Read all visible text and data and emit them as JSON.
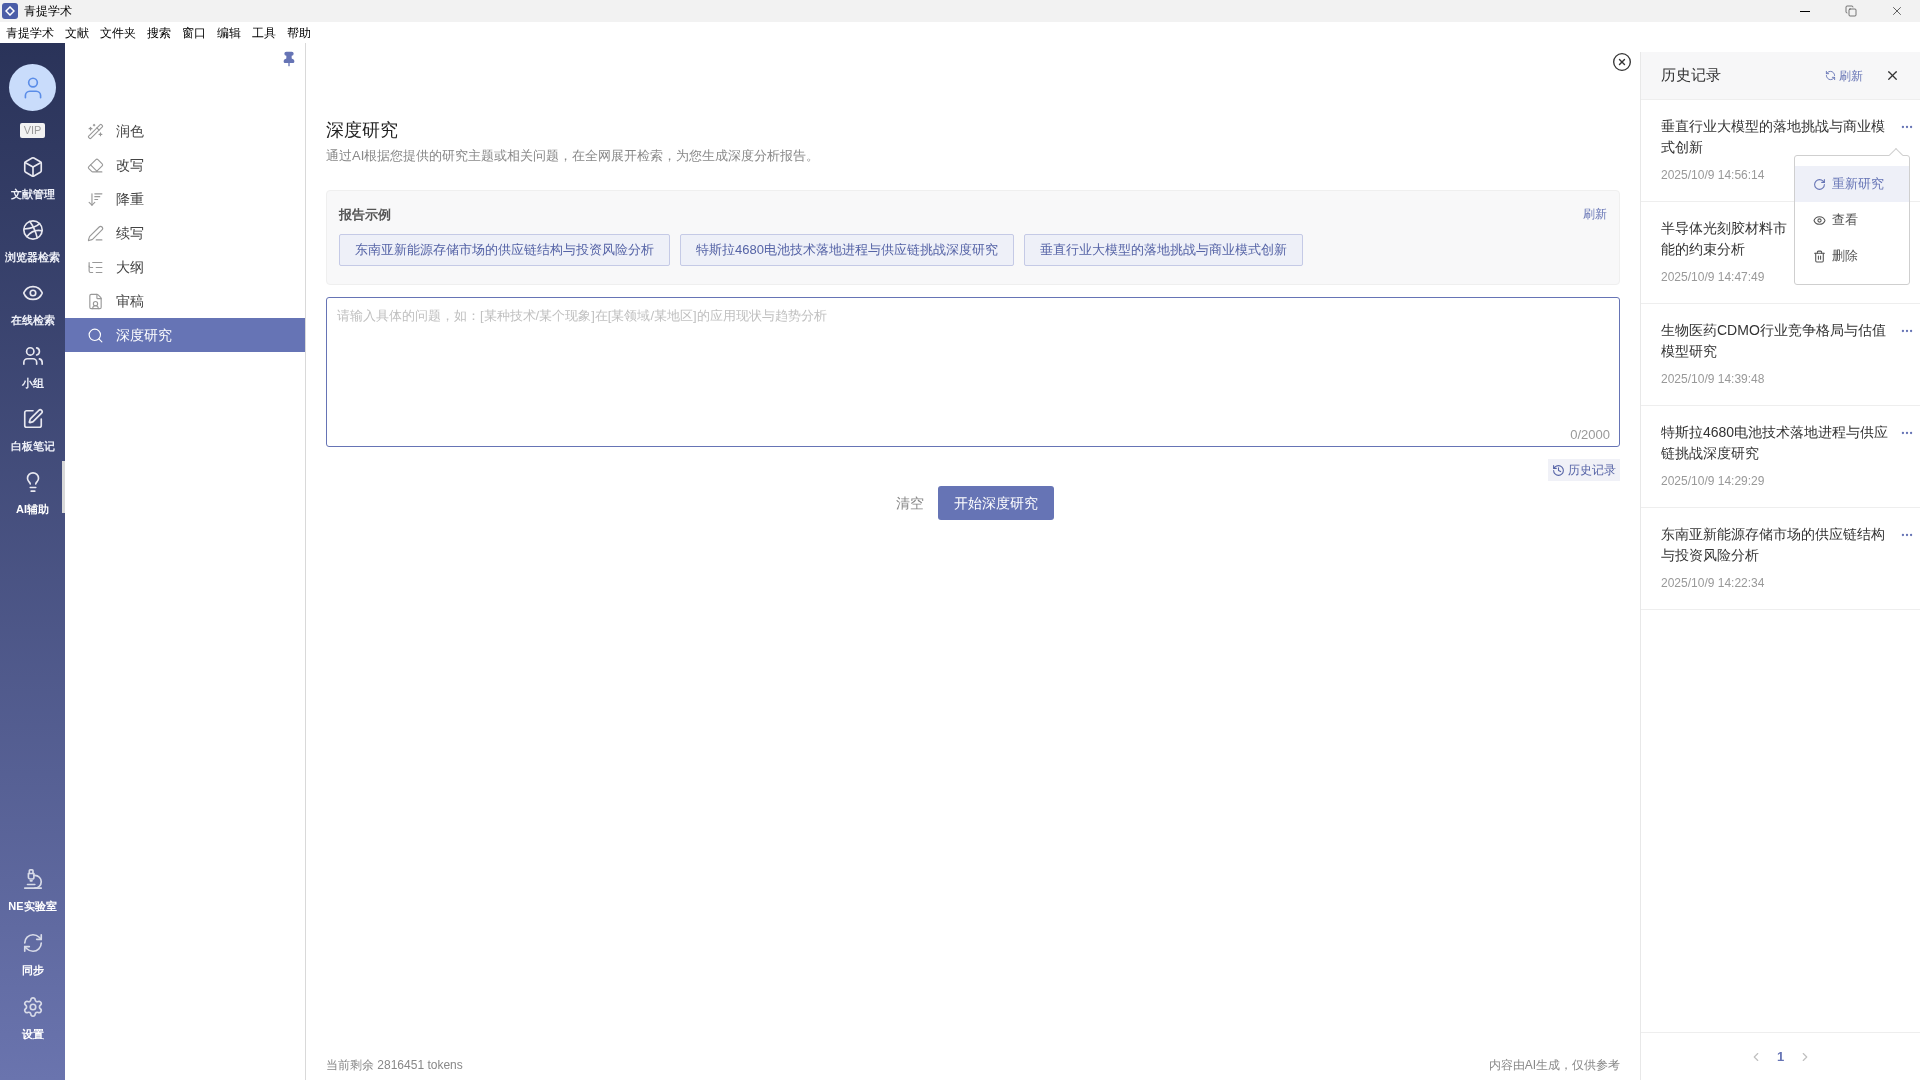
{
  "window": {
    "title": "青提学术"
  },
  "menu_bar": [
    "青提学术",
    "文献",
    "文件夹",
    "搜索",
    "窗口",
    "编辑",
    "工具",
    "帮助"
  ],
  "nav_rail": {
    "badge": "VIP",
    "items": [
      {
        "label": "文献管理",
        "selected": false
      },
      {
        "label": "浏览器检索",
        "selected": false
      },
      {
        "label": "在线检索",
        "selected": false
      },
      {
        "label": "小组",
        "selected": false
      },
      {
        "label": "白板笔记",
        "selected": false
      },
      {
        "label": "AI辅助",
        "selected": true
      }
    ],
    "bottom_items": [
      "NE实验室",
      "同步",
      "设置"
    ]
  },
  "tools": [
    {
      "label": "润色",
      "selected": false
    },
    {
      "label": "改写",
      "selected": false
    },
    {
      "label": "降重",
      "selected": false
    },
    {
      "label": "续写",
      "selected": false
    },
    {
      "label": "大纲",
      "selected": false
    },
    {
      "label": "审稿",
      "selected": false
    },
    {
      "label": "深度研究",
      "selected": true
    }
  ],
  "main": {
    "title": "深度研究",
    "subtitle": "通过AI根据您提供的研究主题或相关问题，在全网展开检索，为您生成深度分析报告。",
    "examples": {
      "title": "报告示例",
      "refresh": "刷新",
      "items": [
        "东南亚新能源存储市场的供应链结构与投资风险分析",
        "特斯拉4680电池技术落地进程与供应链挑战深度研究",
        "垂直行业大模型的落地挑战与商业模式创新"
      ]
    },
    "input": {
      "placeholder": "请输入具体的问题，如：[某种技术/某个现象]在[某领域/某地区]的应用现状与趋势分析",
      "counter": "0/2000"
    },
    "history_button": "历史记录",
    "clear_button": "清空",
    "start_button": "开始深度研究",
    "tokens": "当前剩余 2816451 tokens",
    "disclaimer": "内容由AI生成，仅供参考"
  },
  "history": {
    "title": "历史记录",
    "refresh": "刷新",
    "items": [
      {
        "lines": [
          "垂直行业大模型的落地挑战与商业模",
          "式创新"
        ],
        "time": "2025/10/9 14:56:14",
        "menu_button": true
      },
      {
        "lines": [
          "半导体光刻胶材料市",
          "能的约束分析"
        ],
        "time": "2025/10/9 14:47:49",
        "menu_button": false
      },
      {
        "lines": [
          "生物医药CDMO行业竞争格局与估值",
          "模型研究"
        ],
        "time": "2025/10/9 14:39:48",
        "menu_button": true
      },
      {
        "lines": [
          "特斯拉4680电池技术落地进程与供应",
          "链挑战深度研究"
        ],
        "time": "2025/10/9 14:29:29",
        "menu_button": true
      },
      {
        "lines": [
          "东南亚新能源存储市场的供应链结构",
          "与投资风险分析"
        ],
        "time": "2025/10/9 14:22:34",
        "menu_button": true
      }
    ],
    "page": "1"
  },
  "context_menu": {
    "items": [
      {
        "label": "重新研究",
        "selected": true
      },
      {
        "label": "查看",
        "selected": false
      },
      {
        "label": "删除",
        "selected": false
      }
    ]
  }
}
